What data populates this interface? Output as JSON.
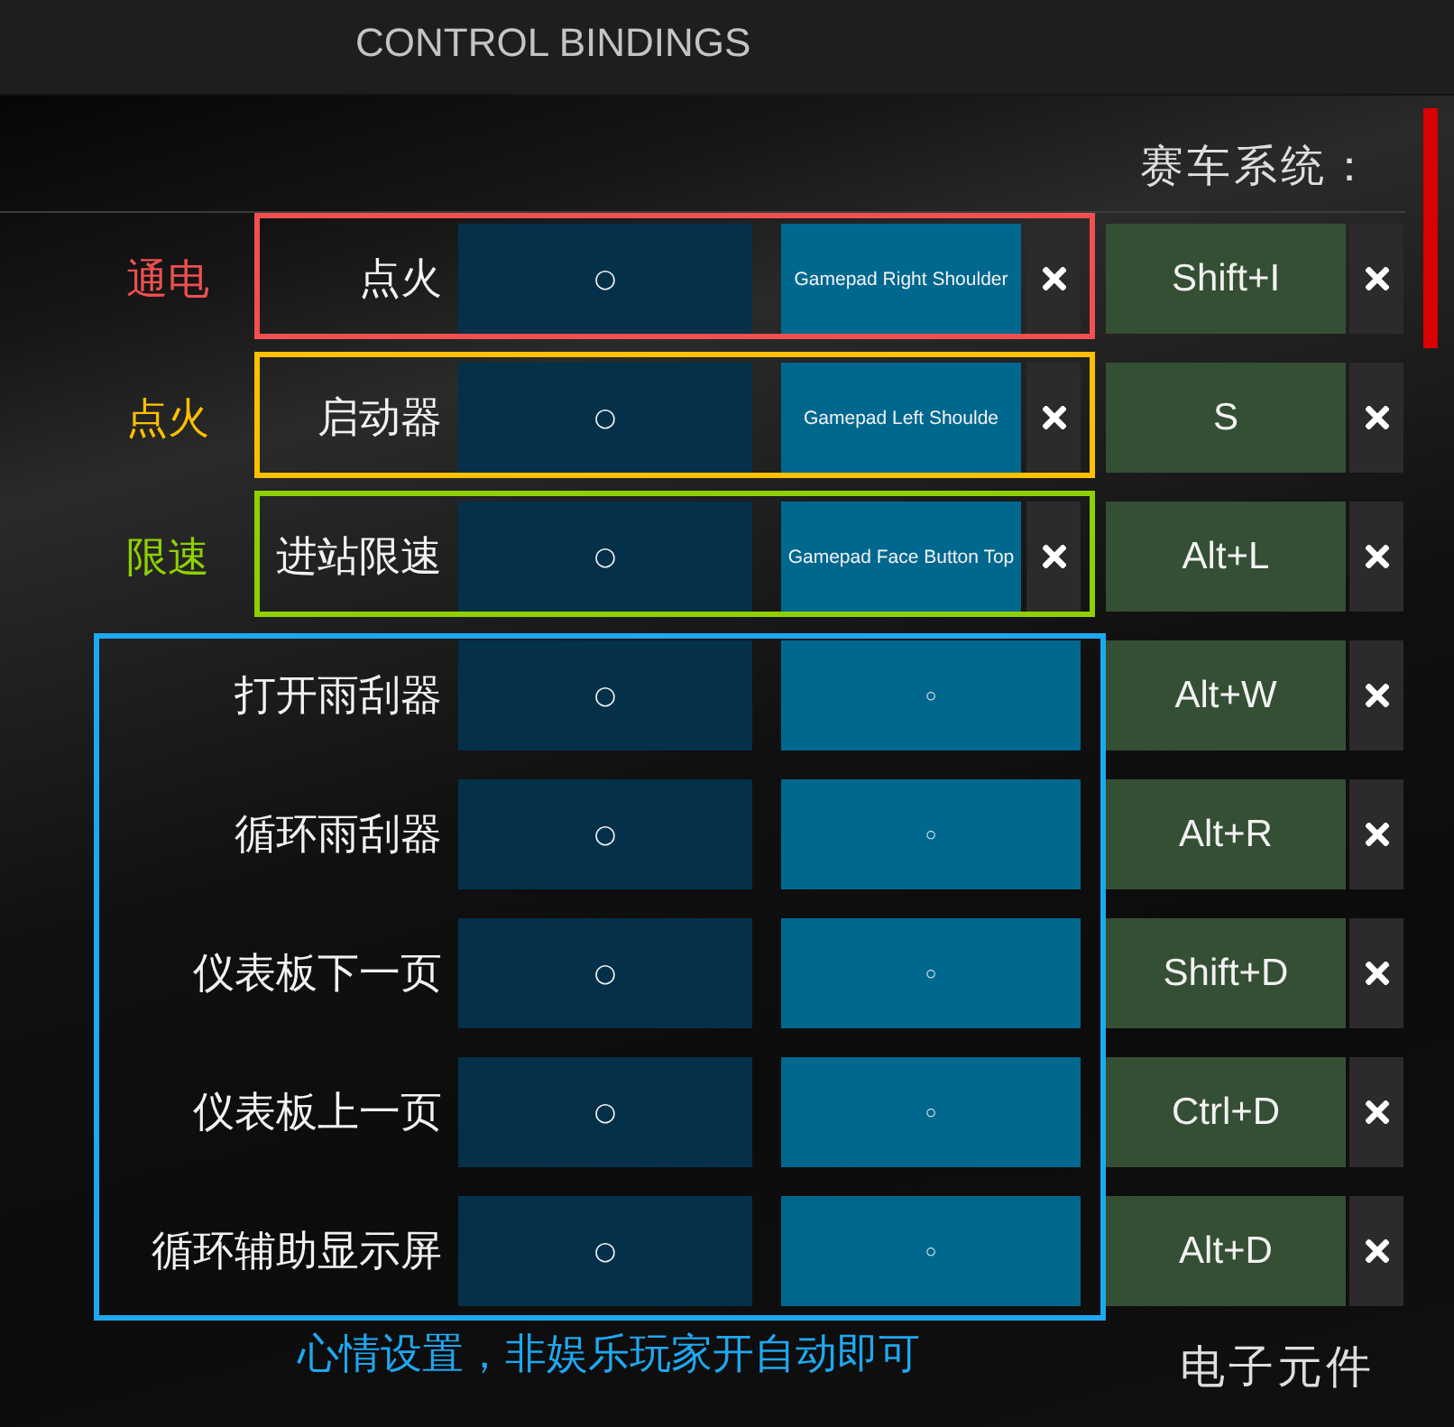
{
  "window": {
    "title": "CONTROL BINDINGS"
  },
  "sections": [
    {
      "title": "赛车系统：",
      "groups": [
        {
          "kind": "side-note",
          "color": "#f05050",
          "note": "通电",
          "bindings": [
            {
              "action": "点火",
              "primary": "○",
              "gamepad": {
                "label": "Gamepad Right Shoulder",
                "clearable": true
              },
              "keyboard": {
                "label": "Shift+I",
                "clearable": true
              }
            }
          ]
        },
        {
          "kind": "side-note",
          "color": "#ffc000",
          "note": "点火",
          "bindings": [
            {
              "action": "启动器",
              "primary": "○",
              "gamepad": {
                "label": "Gamepad Left Shoulde",
                "clearable": true
              },
              "keyboard": {
                "label": "S",
                "clearable": true
              }
            }
          ]
        },
        {
          "kind": "side-note",
          "color": "#8fd000",
          "note": "限速",
          "bindings": [
            {
              "action": "进站限速",
              "primary": "○",
              "gamepad": {
                "label": "Gamepad Face Button Top",
                "clearable": true
              },
              "keyboard": {
                "label": "Alt+L",
                "clearable": true
              }
            }
          ]
        },
        {
          "kind": "below-note",
          "color": "#1ea8f0",
          "note": "心情设置，非娱乐玩家开自动即可",
          "bindings": [
            {
              "action": "打开雨刮器",
              "primary": "○",
              "gamepad": {
                "label": "○",
                "clearable": false
              },
              "keyboard": {
                "label": "Alt+W",
                "clearable": true
              }
            },
            {
              "action": "循环雨刮器",
              "primary": "○",
              "gamepad": {
                "label": "○",
                "clearable": false
              },
              "keyboard": {
                "label": "Alt+R",
                "clearable": true
              }
            },
            {
              "action": "仪表板下一页",
              "primary": "○",
              "gamepad": {
                "label": "○",
                "clearable": false
              },
              "keyboard": {
                "label": "Shift+D",
                "clearable": true
              }
            },
            {
              "action": "仪表板上一页",
              "primary": "○",
              "gamepad": {
                "label": "○",
                "clearable": false
              },
              "keyboard": {
                "label": "Ctrl+D",
                "clearable": true
              }
            },
            {
              "action": "循环辅助显示屏",
              "primary": "○",
              "gamepad": {
                "label": "○",
                "clearable": false
              },
              "keyboard": {
                "label": "Alt+D",
                "clearable": true
              }
            }
          ]
        }
      ]
    },
    {
      "title": "电子元件"
    }
  ]
}
